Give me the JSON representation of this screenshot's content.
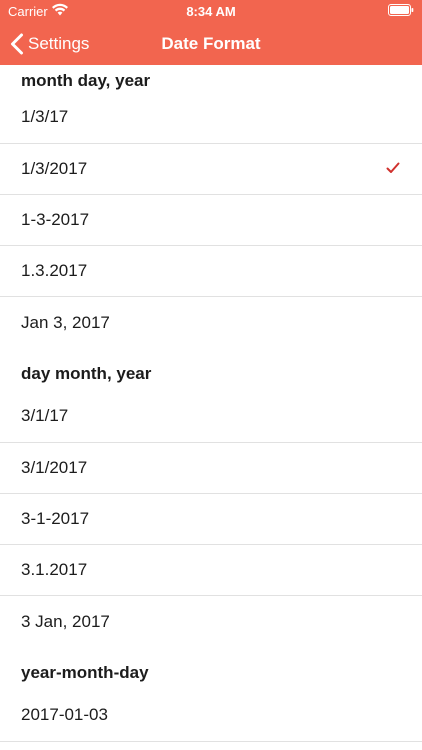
{
  "status_bar": {
    "carrier": "Carrier",
    "time": "8:34 AM"
  },
  "nav": {
    "back_label": "Settings",
    "title": "Date Format"
  },
  "colors": {
    "header_bg": "#f2654f",
    "check": "#d0312d"
  },
  "sections": [
    {
      "title": "month day, year",
      "options": [
        "1/3/17",
        "1/3/2017",
        "1-3-2017",
        "1.3.2017",
        "Jan 3, 2017"
      ]
    },
    {
      "title": "day month, year",
      "options": [
        "3/1/17",
        "3/1/2017",
        "3-1-2017",
        "3.1.2017",
        "3 Jan, 2017"
      ]
    },
    {
      "title": "year-month-day",
      "options": [
        "2017-01-03"
      ]
    }
  ],
  "selected": "1/3/2017"
}
